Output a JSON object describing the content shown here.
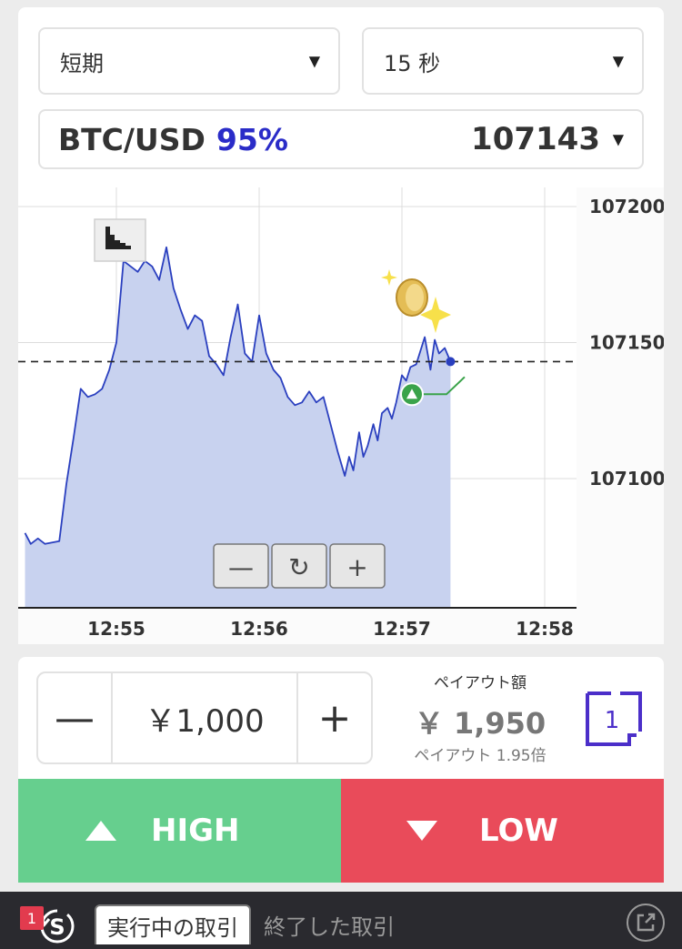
{
  "controls": {
    "term": "短期",
    "duration": "15 秒",
    "asset_name": "BTC/USD",
    "asset_payout_pct": "95%",
    "asset_price": "107143",
    "caret": "▼"
  },
  "chart_data": {
    "type": "line",
    "y_ticks": [
      "107200",
      "107150",
      "107100"
    ],
    "y_tick_values": [
      107200,
      107150,
      107100
    ],
    "ylim": [
      107054,
      107207
    ],
    "x_ticks": [
      "12:55",
      "12:56",
      "12:57",
      "12:58"
    ],
    "x_tick_minutes": [
      655,
      656,
      657,
      658
    ],
    "xlim": [
      654.35,
      658.25
    ],
    "reference_price": 107143,
    "entry_point": {
      "x": 657.07,
      "y": 107131
    },
    "grid": true,
    "series_color": "#2a3fbf",
    "fill_color": "#c8d2ef",
    "x": [
      654.36,
      654.4,
      654.45,
      654.5,
      654.6,
      654.65,
      654.7,
      654.75,
      654.8,
      654.85,
      654.9,
      654.95,
      655.0,
      655.05,
      655.1,
      655.15,
      655.2,
      655.25,
      655.3,
      655.35,
      655.4,
      655.45,
      655.5,
      655.55,
      655.6,
      655.65,
      655.7,
      655.75,
      655.8,
      655.85,
      655.9,
      655.95,
      656.0,
      656.05,
      656.1,
      656.15,
      656.2,
      656.25,
      656.3,
      656.35,
      656.4,
      656.45,
      656.5,
      656.55,
      656.6,
      656.63,
      656.66,
      656.7,
      656.73,
      656.76,
      656.8,
      656.83,
      656.86,
      656.9,
      656.93,
      656.96,
      657.0,
      657.03,
      657.06,
      657.1,
      657.13,
      657.16,
      657.2,
      657.23,
      657.26,
      657.3,
      657.34
    ],
    "y": [
      107080,
      107076,
      107078,
      107076,
      107077,
      107098,
      107115,
      107133,
      107130,
      107131,
      107133,
      107140,
      107150,
      107180,
      107178,
      107176,
      107180,
      107178,
      107173,
      107185,
      107170,
      107162,
      107155,
      107160,
      107158,
      107145,
      107142,
      107138,
      107152,
      107164,
      107146,
      107143,
      107160,
      107146,
      107140,
      107137,
      107130,
      107127,
      107128,
      107132,
      107128,
      107130,
      107120,
      107110,
      107101,
      107108,
      107103,
      107117,
      107108,
      107112,
      107120,
      107114,
      107124,
      107126,
      107122,
      107128,
      107138,
      107136,
      107141,
      107142,
      107147,
      107152,
      107140,
      107151,
      107146,
      107148,
      107143
    ]
  },
  "chart_controls": {
    "zoom_out": "—",
    "reset": "↻",
    "zoom_in": "+"
  },
  "amount": {
    "minus": "—",
    "value": "￥1,000",
    "plus": "+"
  },
  "payout": {
    "label": "ペイアウト額",
    "value": "￥ 1,950",
    "multiplier": "ペイアウト 1.95倍"
  },
  "multi_trade": {
    "count": "1"
  },
  "buttons": {
    "high": "HIGH",
    "low": "LOW"
  },
  "bottom_bar": {
    "badge": "1",
    "icon_letter": "S",
    "active_tab": "実行中の取引",
    "inactive_tab": "終了した取引"
  },
  "colors": {
    "accent_blue": "#2a2cc8",
    "high_green": "#66cf8e",
    "low_red": "#e94b5a",
    "multi_purple": "#4b2fc9"
  }
}
